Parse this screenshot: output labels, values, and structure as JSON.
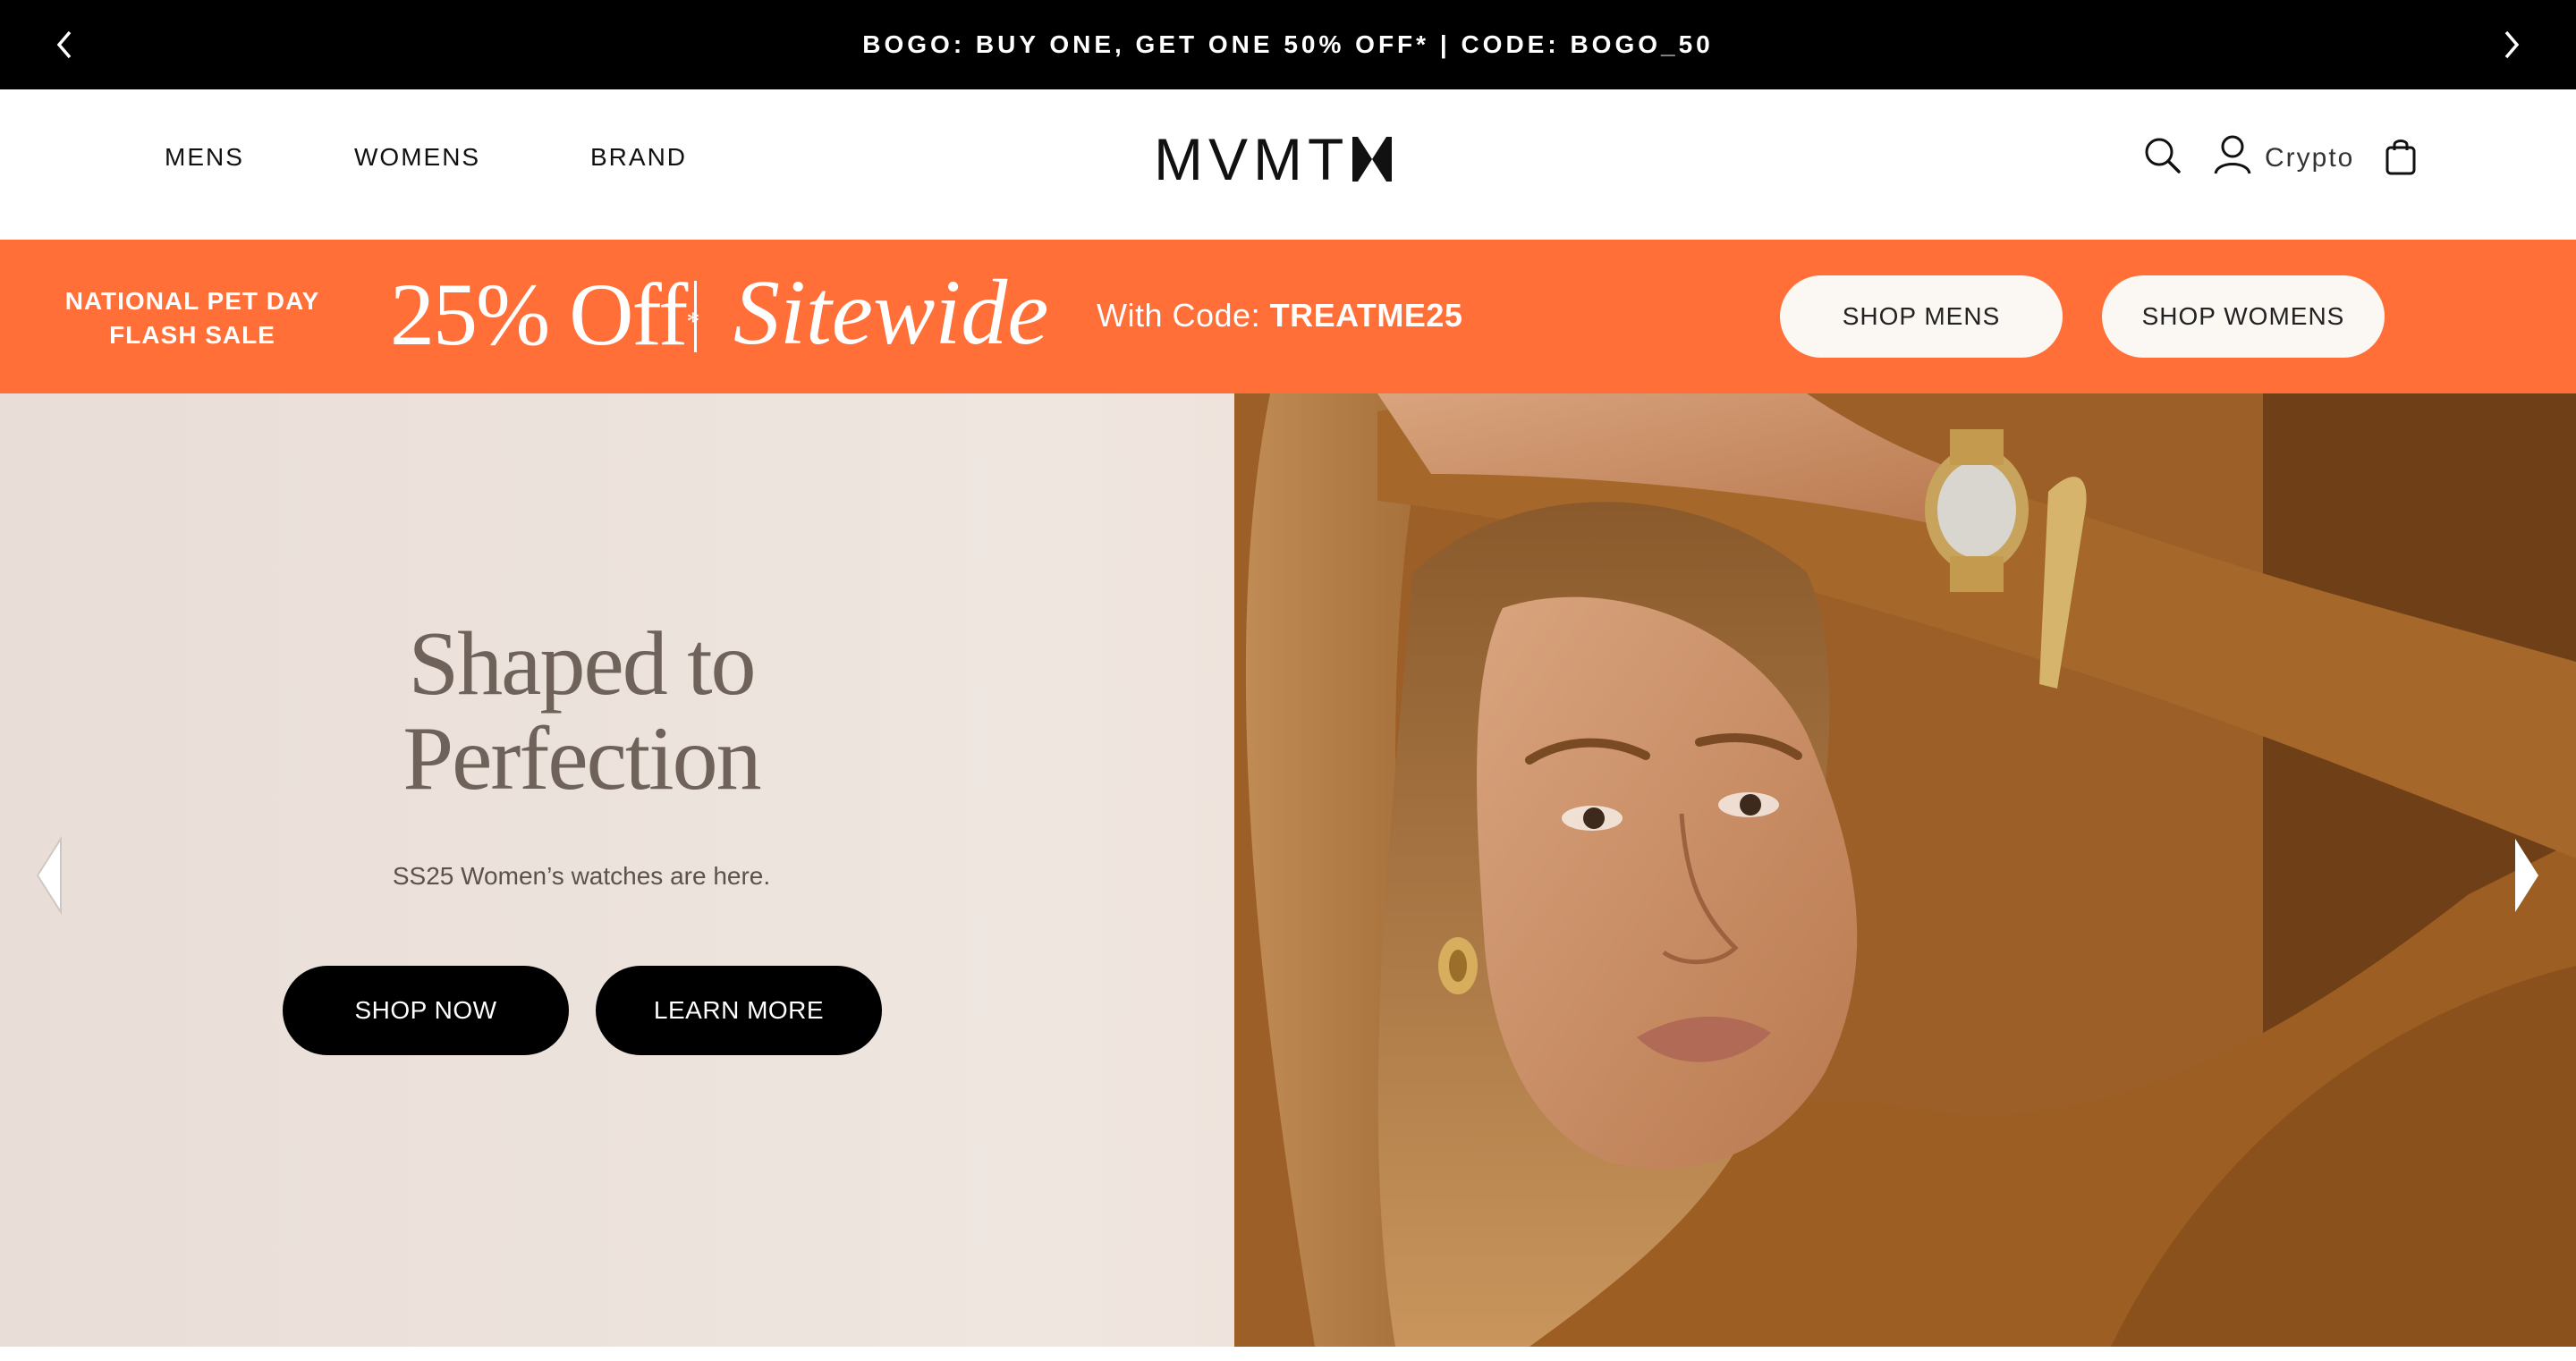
{
  "announcement": {
    "text": "BOGO: BUY ONE, GET ONE 50% OFF* | CODE: BOGO_50",
    "prev_icon": "chevron-left-icon",
    "next_icon": "chevron-right-icon"
  },
  "header": {
    "nav": [
      {
        "label": "MENS"
      },
      {
        "label": "WOMENS"
      },
      {
        "label": "BRAND"
      }
    ],
    "logo": "MVMT",
    "icons": {
      "search": "search-icon",
      "account": "user-icon",
      "cart": "shopping-bag-icon"
    },
    "crypto_label": "Crypto"
  },
  "promo": {
    "flash_line1": "NATIONAL PET DAY",
    "flash_line2": "FLASH SALE",
    "discount": "25% Off",
    "discount_mark": "*",
    "sitewide": "Sitewide",
    "code_prefix": "With Code: ",
    "code": "TREATME25",
    "shop_mens": "SHOP MENS",
    "shop_womens": "SHOP WOMENS",
    "bg_color": "#ff6f37"
  },
  "hero": {
    "title_line1": "Shaped to",
    "title_line2": "Perfection",
    "subtitle": "SS25 Women’s watches are here.",
    "shop_now": "SHOP NOW",
    "learn_more": "LEARN MORE",
    "prev_icon": "carousel-prev-icon",
    "next_icon": "carousel-next-icon"
  }
}
